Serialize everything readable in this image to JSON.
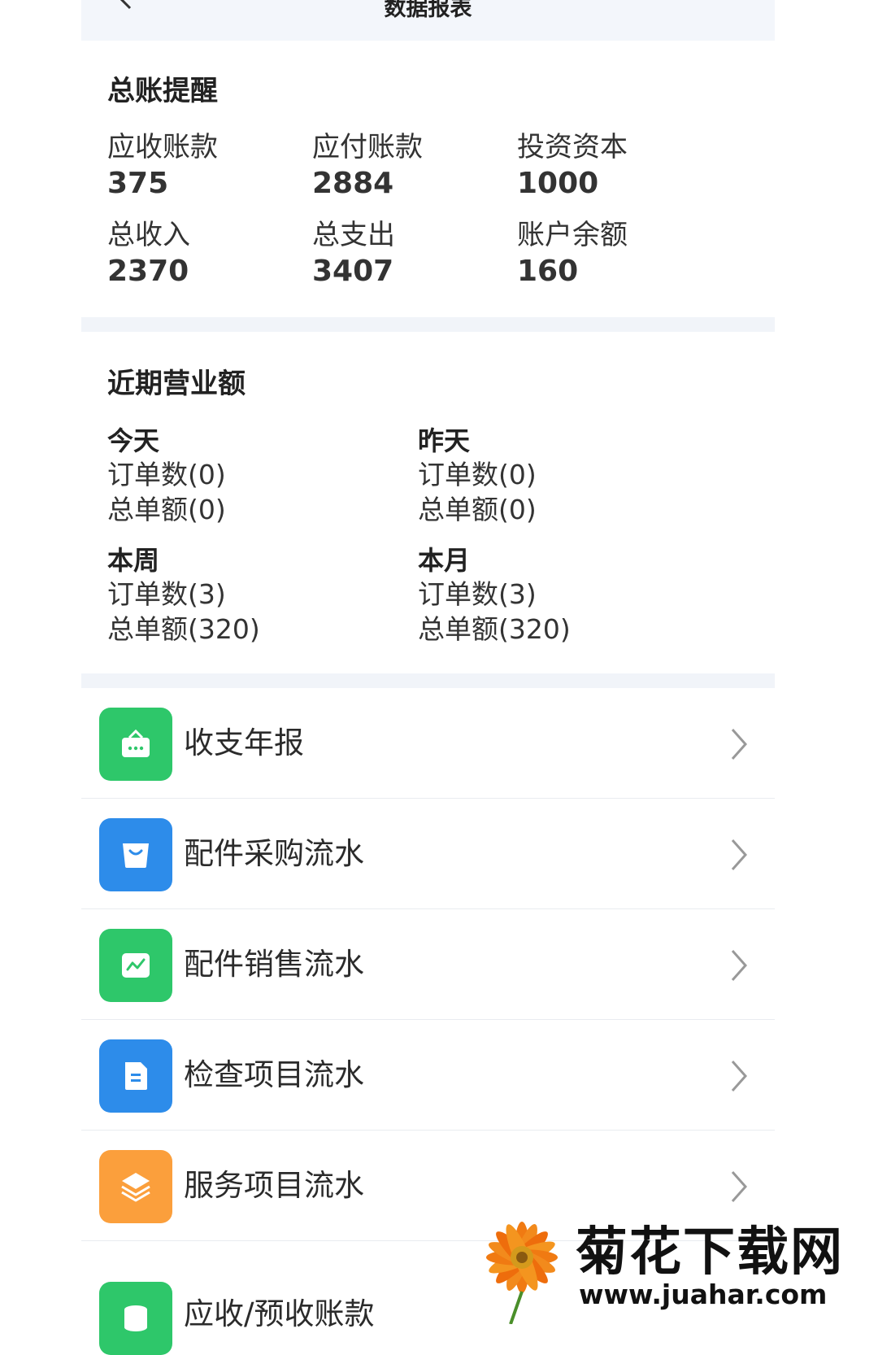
{
  "header": {
    "title": "数据报表"
  },
  "ledger": {
    "title": "总账提醒",
    "items": [
      {
        "label": "应收账款",
        "value": "375"
      },
      {
        "label": "应付账款",
        "value": "2884"
      },
      {
        "label": "投资资本",
        "value": "1000"
      },
      {
        "label": "总收入",
        "value": "2370"
      },
      {
        "label": "总支出",
        "value": "3407"
      },
      {
        "label": "账户余额",
        "value": "160"
      }
    ]
  },
  "revenue": {
    "title": "近期营业额",
    "periods": [
      {
        "name": "今天",
        "orders": "订单数(0)",
        "amount": "总单额(0)"
      },
      {
        "name": "昨天",
        "orders": "订单数(0)",
        "amount": "总单额(0)"
      },
      {
        "name": "本周",
        "orders": "订单数(3)",
        "amount": "总单额(320)"
      },
      {
        "name": "本月",
        "orders": "订单数(3)",
        "amount": "总单额(320)"
      }
    ]
  },
  "menu": {
    "items": [
      {
        "label": "收支年报",
        "icon": "shop-bag-icon",
        "color": "#2ec76a"
      },
      {
        "label": "配件采购流水",
        "icon": "shopping-bag-icon",
        "color": "#2d8cea"
      },
      {
        "label": "配件销售流水",
        "icon": "trend-chart-icon",
        "color": "#2ec76a"
      },
      {
        "label": "检查项目流水",
        "icon": "document-icon",
        "color": "#2d8cea"
      },
      {
        "label": "服务项目流水",
        "icon": "layers-icon",
        "color": "#fb9f3c"
      },
      {
        "label": "应收/预收账款",
        "icon": "coin-stack-icon",
        "color": "#2ec76a"
      }
    ]
  },
  "watermark": {
    "brand": "菊花下载网",
    "url": "www.juahar.com"
  }
}
